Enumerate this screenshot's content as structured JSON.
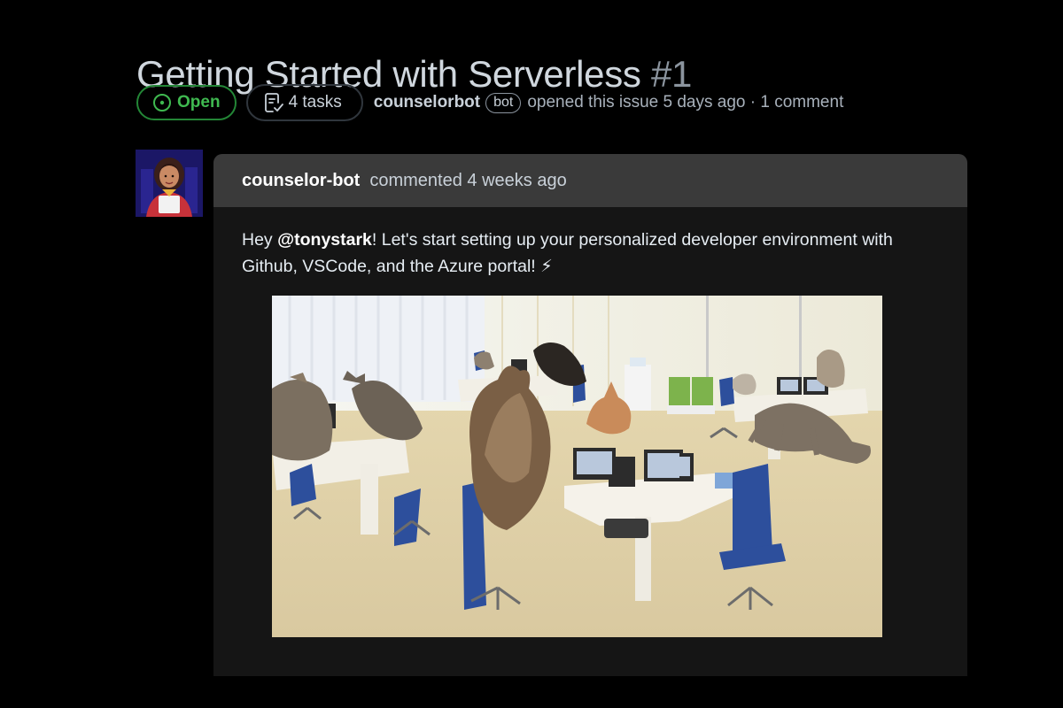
{
  "issue": {
    "title": "Getting Started with Serverless",
    "number": "#1",
    "state_label": "Open",
    "tasks_label": "4 tasks",
    "author": "counselorbot",
    "author_badge": "bot",
    "meta_text": "opened this issue 5 days ago · 1 comment"
  },
  "comment": {
    "author": "counselor-bot",
    "time_text": "commented 4 weeks ago",
    "body_prefix": "Hey ",
    "mention": "@tonystark",
    "body_suffix": "! Let's start setting up your personalized developer environment with Github, VSCode, and the Azure portal! ⚡"
  },
  "icons": {
    "state": "issue-opened-icon",
    "tasks": "checklist-icon"
  },
  "colors": {
    "background": "#000000",
    "open_green": "#3fb950",
    "comment_header": "#3a3a3a",
    "comment_body": "#151515",
    "avatar_bg": "#1b1766"
  }
}
